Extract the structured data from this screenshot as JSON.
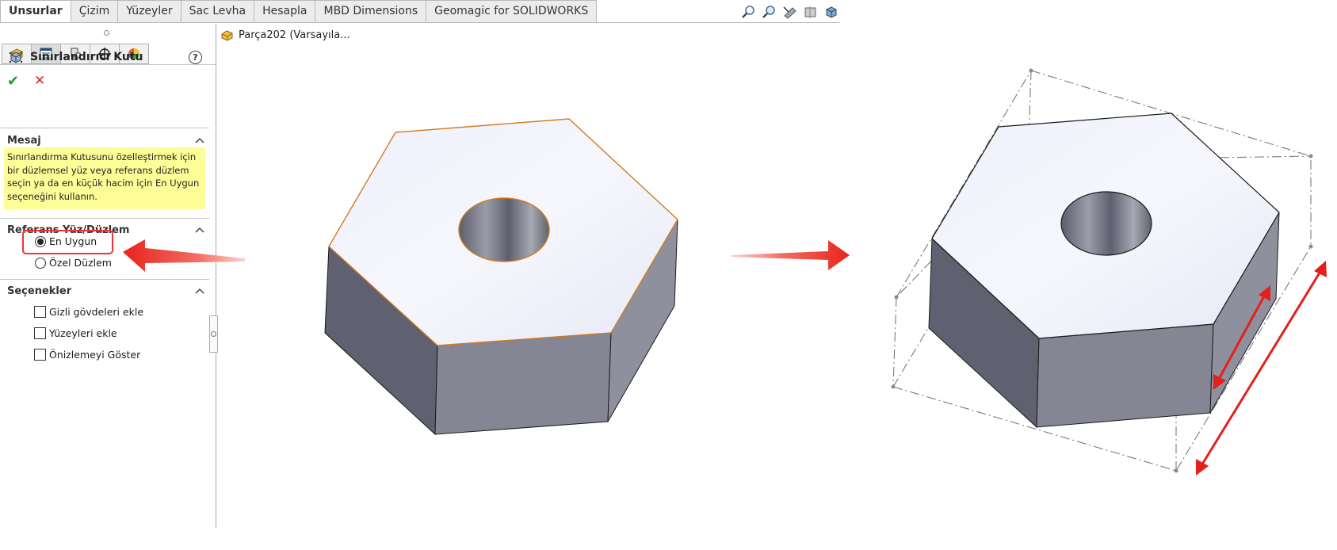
{
  "tabs": [
    {
      "label": "Unsurlar",
      "active": true
    },
    {
      "label": "Çizim",
      "active": false
    },
    {
      "label": "Yüzeyler",
      "active": false
    },
    {
      "label": "Sac Levha",
      "active": false
    },
    {
      "label": "Hesapla",
      "active": false
    },
    {
      "label": "MBD Dimensions",
      "active": false
    },
    {
      "label": "Geomagic for SOLIDWORKS",
      "active": false
    }
  ],
  "view_tools": [
    "zoom-to-fit-icon",
    "zoom-to-area-icon",
    "previous-view-icon",
    "section-view-icon",
    "view-orientation-icon"
  ],
  "feature_tree": {
    "root_label": "Parça202  (Varsayıla..."
  },
  "property_manager": {
    "tabs": [
      "feature-manager-icon",
      "property-manager-icon",
      "configuration-manager-icon",
      "dimxpert-icon",
      "display-manager-icon"
    ],
    "title": "Sınırlandırıcı Kutu",
    "help": "?",
    "message_section": {
      "title": "Mesaj",
      "lines": [
        "Sınırlandırma Kutusunu özelleştirmek için",
        "bir düzlemsel yüz veya referans düzlem",
        "seçin ya da en küçük hacim için En Uygun",
        "seçeneğini kullanın."
      ]
    },
    "reference_section": {
      "title": "Referans Yüz/Düzlem",
      "options": [
        {
          "label": "En Uygun",
          "selected": true
        },
        {
          "label": "Özel Düzlem",
          "selected": false
        }
      ]
    },
    "options_section": {
      "title": "Seçenekler",
      "checkboxes": [
        {
          "label": "Gizli gövdeleri ekle",
          "checked": false
        },
        {
          "label": "Yüzeyleri ekle",
          "checked": false
        },
        {
          "label": "Önizlemeyi Göster",
          "checked": false
        }
      ]
    }
  },
  "colors": {
    "accent_red": "#e8231d",
    "message_bg": "#fdfd98",
    "ok_green": "#1f9e27",
    "cancel_red": "#c8321e",
    "edge_orange": "#d27a1e"
  }
}
